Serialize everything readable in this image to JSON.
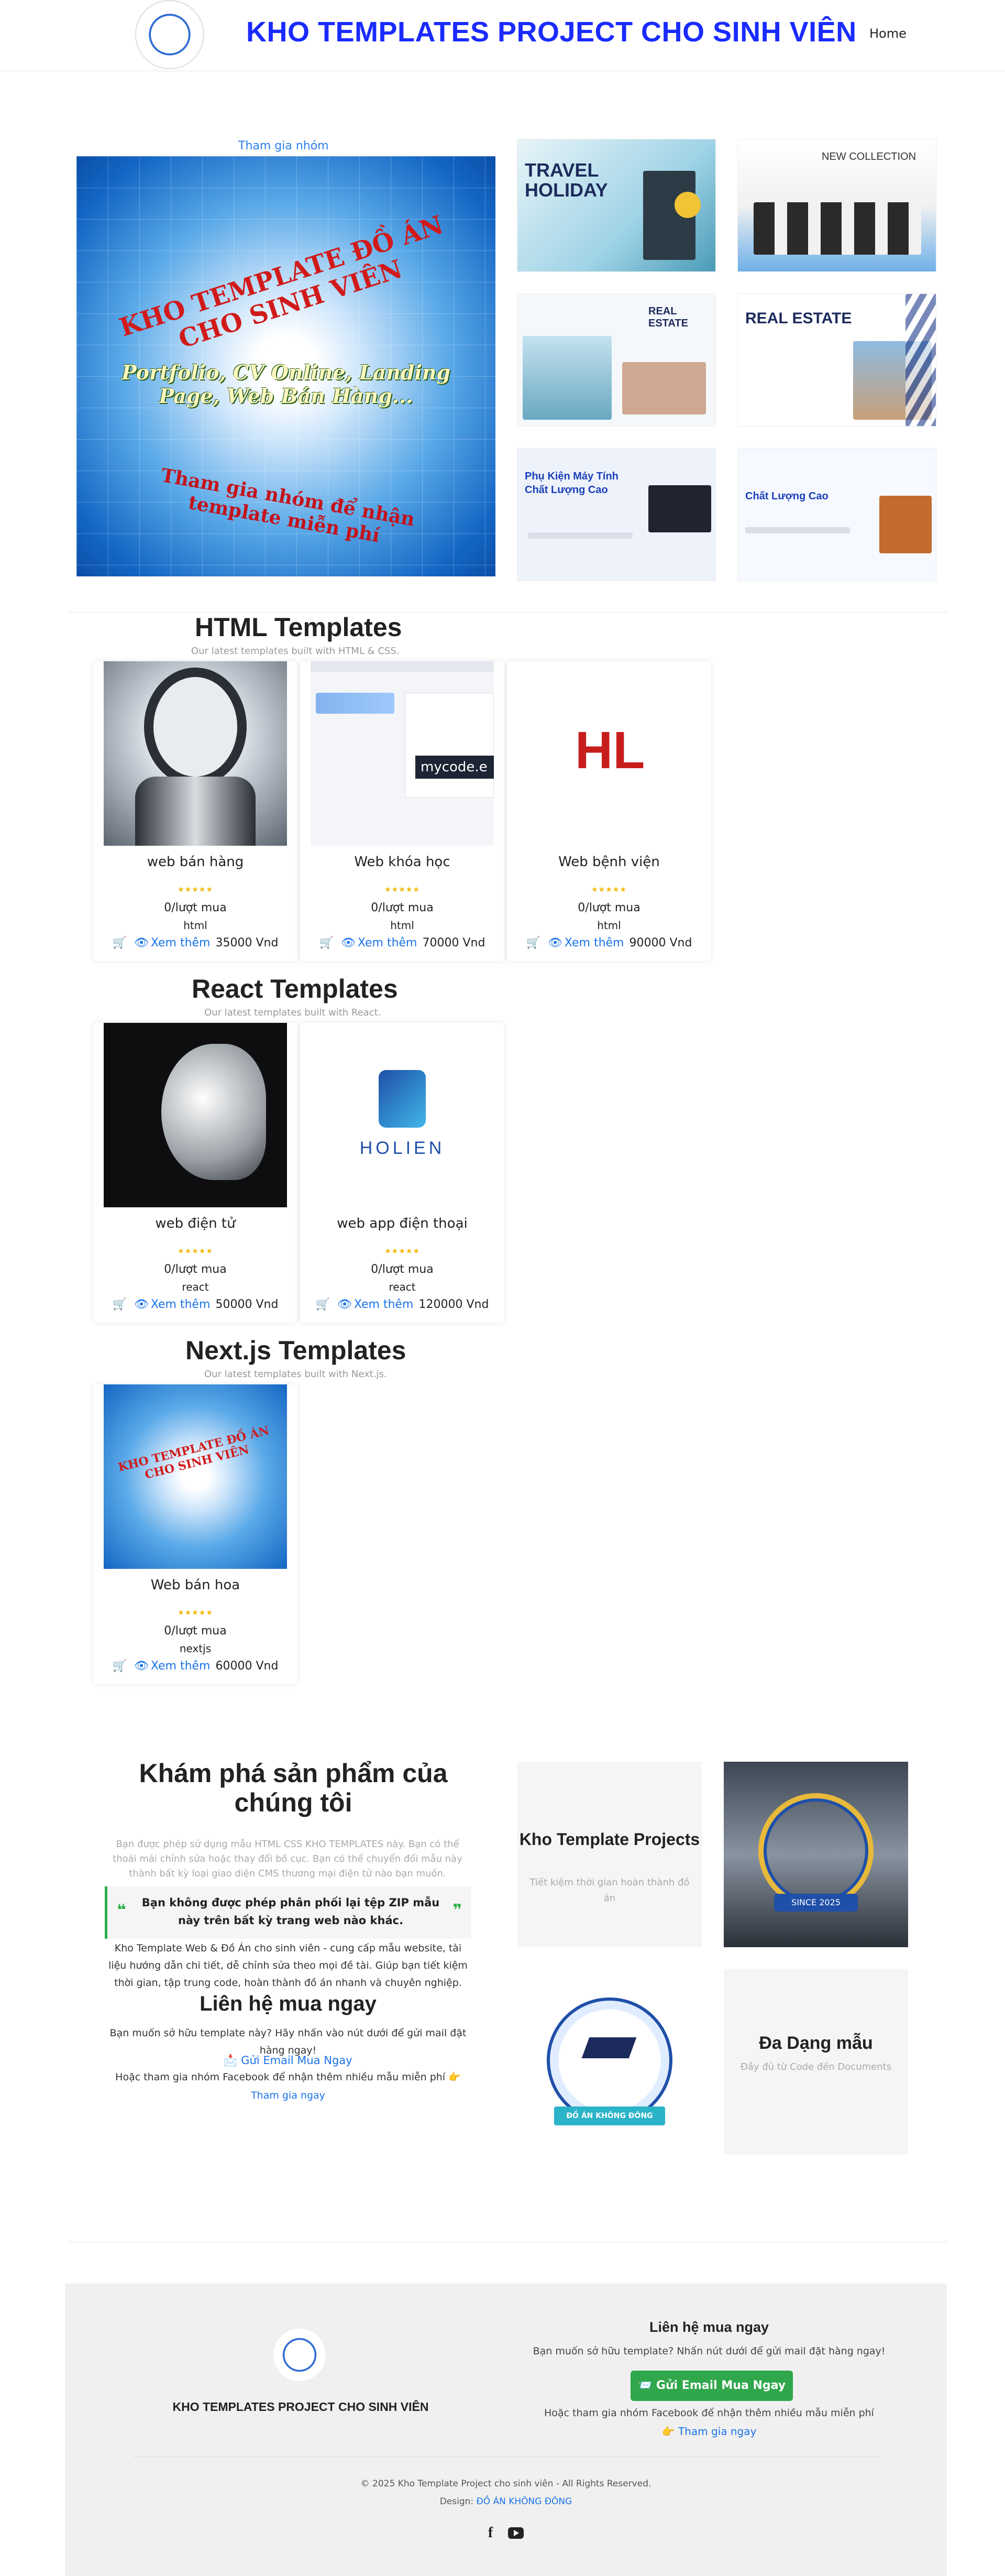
{
  "header": {
    "title": "KHO TEMPLATES PROJECT CHO SINH VIÊN",
    "nav_home": "Home"
  },
  "hero": {
    "join_link": "Tham gia nhóm",
    "banner_line1": "KHO TEMPLATE ĐỒ ÁN CHO SINH VIÊN",
    "banner_line2": "Portfolio, CV Online, Landing Page, Web Bán Hàng...",
    "banner_line3": "Tham gia nhóm để nhận template miễn phí",
    "thumbs": [
      {
        "heading": "TRAVEL HOLIDAY"
      },
      {
        "heading": "NEW COLLECTION"
      },
      {
        "heading": "REAL ESTATE"
      },
      {
        "heading": "REAL ESTATE"
      },
      {
        "heading": "Phụ Kiện Máy Tính Chất Lượng Cao"
      },
      {
        "heading": "Chất Lượng Cao"
      }
    ]
  },
  "sections": {
    "html": {
      "title": "HTML Templates",
      "subtitle": "Our latest templates built with HTML & CSS."
    },
    "react": {
      "title": "React Templates",
      "subtitle": "Our latest templates built with React."
    },
    "next": {
      "title": "Next.js Templates",
      "subtitle": "Our latest templates built with Next.js."
    }
  },
  "products": {
    "stars": "★★★★★",
    "more_label": "Xem thêm",
    "html": [
      {
        "name": "web bán hàng",
        "sold": "0/lượt mua",
        "tech": "html",
        "price": "35000 Vnd"
      },
      {
        "name": "Web khóa học",
        "sold": "0/lượt mua",
        "tech": "html",
        "price": "70000 Vnd"
      },
      {
        "name": "Web bệnh viện",
        "sold": "0/lượt mua",
        "tech": "html",
        "price": "90000 Vnd"
      }
    ],
    "react": [
      {
        "name": "web điện tử",
        "sold": "0/lượt mua",
        "tech": "react",
        "price": "50000 Vnd"
      },
      {
        "name": "web app điện thoại",
        "sold": "0/lượt mua",
        "tech": "react",
        "price": "120000 Vnd"
      }
    ],
    "next": [
      {
        "name": "Web bán hoa",
        "sold": "0/lượt mua",
        "tech": "nextjs",
        "price": "60000 Vnd"
      }
    ],
    "img_text": {
      "course_badge": "mycode.e",
      "holien": "HOLIEN",
      "hl": "HL"
    }
  },
  "explore": {
    "title": "Khám phá sản phẩm của chúng tôi",
    "p1": "Bạn được phép sử dụng mẫu HTML CSS KHO TEMPLATES này. Bạn có thể thoải mái chỉnh sửa hoặc thay đổi bố cục. Bạn có thể chuyển đổi mẫu này thành bất kỳ loại giao diện CMS thương mại điện tử nào bạn muốn.",
    "quote": "Bạn không được phép phân phối lại tệp ZIP mẫu này trên bất kỳ trang web nào khác.",
    "p2": "Kho Template Web & Đồ Án cho sinh viên - cung cấp mẫu website, tài liệu hướng dẫn chi tiết, dễ chỉnh sửa theo mọi đề tài. Giúp bạn tiết kiệm thời gian, tập trung code, hoàn thành đồ án nhanh và chuyên nghiệp.",
    "contact_title": "Liên hệ mua ngay",
    "contact_p": "Bạn muốn sở hữu template này? Hãy nhấn vào nút dưới để gửi mail đặt hàng ngay!",
    "mail_link": "📩 Gửi Email Mua Ngay",
    "fb_p": "Hoặc tham gia nhóm Facebook để nhận thêm nhiều mẫu miễn phí 👉",
    "join_link": "Tham gia ngay",
    "box1_title": "Kho Template Projects",
    "box1_sub": "Tiết kiệm thời gian hoàn thành đồ án",
    "box2_badge": "SINCE 2025",
    "box3_badge": "ĐỒ ÁN KHÔNG ĐÔNG",
    "box4_title": "Đa Dạng mẫu",
    "box4_sub": "Đầy đủ từ Code đến Documents"
  },
  "footer": {
    "brand": "KHO TEMPLATES PROJECT CHO SINH VIÊN",
    "contact_title": "Liên hệ mua ngay",
    "contact_p": "Bạn muốn sở hữu template? Nhấn nút dưới để gửi mail đặt hàng ngay!",
    "button": "📨 Gửi Email Mua Ngay",
    "fb_p": "Hoặc tham gia nhóm Facebook để nhận thêm nhiều mẫu miễn phí",
    "join_link": "👉 Tham gia ngay",
    "copyright": "© 2025 Kho Template Project cho sinh viên - All Rights Reserved.",
    "design_label": "Design:",
    "design_link": "ĐỒ ÁN KHÔNG ĐÔNG",
    "social": [
      "facebook-icon",
      "youtube-icon"
    ]
  },
  "colors": {
    "title_blue": "#1a2bff",
    "link_blue": "#1a73e8",
    "green": "#2fa74a",
    "star": "#f1b90a"
  }
}
